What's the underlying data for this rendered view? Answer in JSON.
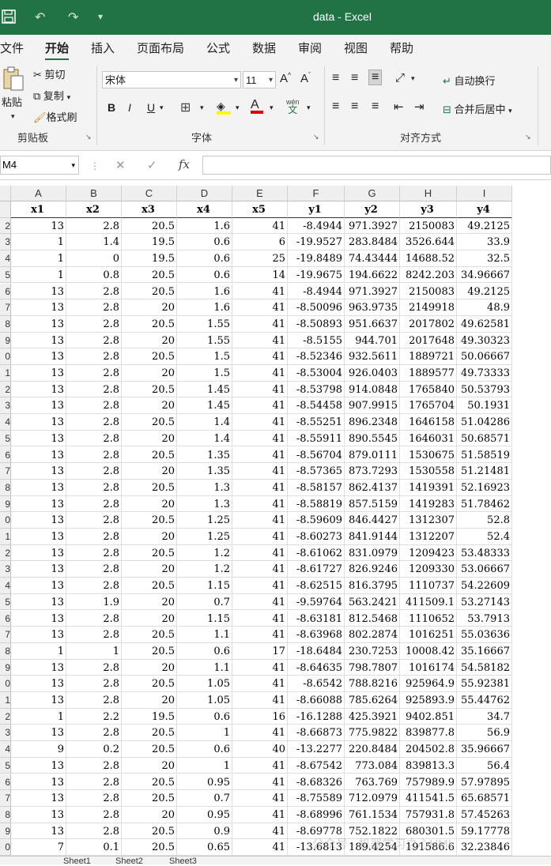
{
  "titlebar": {
    "title": "data  -  Excel",
    "accent": "#217346"
  },
  "tabs": [
    "文件",
    "开始",
    "插入",
    "页面布局",
    "公式",
    "数据",
    "审阅",
    "视图",
    "帮助"
  ],
  "clipboard": {
    "paste": "粘贴",
    "cut": "剪切",
    "copy": "复制",
    "format_painter": "格式刷",
    "label": "剪贴板"
  },
  "font": {
    "name": "宋体",
    "size": "11",
    "bold": "B",
    "italic": "I",
    "underline": "U",
    "label": "字体",
    "grow": "A^",
    "shrink": "Aˇ",
    "phonetic": "wén"
  },
  "alignment": {
    "wrap": "自动换行",
    "merge": "合并后居中",
    "label": "对齐方式"
  },
  "formula_bar": {
    "name_box": "M4",
    "fx": "fx",
    "cancel": "✕",
    "enter": "✓"
  },
  "columns": [
    "A",
    "B",
    "C",
    "D",
    "E",
    "F",
    "G",
    "H",
    "I"
  ],
  "row_labels": [
    "",
    "2",
    "3",
    "4",
    "5",
    "6",
    "7",
    "8",
    "9",
    "0",
    "1",
    "2",
    "3",
    "4",
    "5",
    "6",
    "7",
    "8",
    "9",
    "0",
    "1",
    "2",
    "3",
    "4",
    "5",
    "6",
    "7",
    "8",
    "9",
    "0",
    "1",
    "2",
    "3",
    "4",
    "5",
    "6",
    "7",
    "8",
    "9",
    "0"
  ],
  "header_row": [
    "x1",
    "x2",
    "x3",
    "x4",
    "x5",
    "y1",
    "y2",
    "y3",
    "y4"
  ],
  "rows": [
    [
      "13",
      "2.8",
      "20.5",
      "1.6",
      "41",
      "-8.4944",
      "971.3927",
      "2150083",
      "49.2125"
    ],
    [
      "1",
      "1.4",
      "19.5",
      "0.6",
      "6",
      "-19.9527",
      "283.8484",
      "3526.644",
      "33.9"
    ],
    [
      "1",
      "0",
      "19.5",
      "0.6",
      "25",
      "-19.8489",
      "74.43444",
      "14688.52",
      "32.5"
    ],
    [
      "1",
      "0.8",
      "20.5",
      "0.6",
      "14",
      "-19.9675",
      "194.6622",
      "8242.203",
      "34.96667"
    ],
    [
      "13",
      "2.8",
      "20.5",
      "1.6",
      "41",
      "-8.4944",
      "971.3927",
      "2150083",
      "49.2125"
    ],
    [
      "13",
      "2.8",
      "20",
      "1.6",
      "41",
      "-8.50096",
      "963.9735",
      "2149918",
      "48.9"
    ],
    [
      "13",
      "2.8",
      "20.5",
      "1.55",
      "41",
      "-8.50893",
      "951.6637",
      "2017802",
      "49.62581"
    ],
    [
      "13",
      "2.8",
      "20",
      "1.55",
      "41",
      "-8.5155",
      "944.701",
      "2017648",
      "49.30323"
    ],
    [
      "13",
      "2.8",
      "20.5",
      "1.5",
      "41",
      "-8.52346",
      "932.5611",
      "1889721",
      "50.06667"
    ],
    [
      "13",
      "2.8",
      "20",
      "1.5",
      "41",
      "-8.53004",
      "926.0403",
      "1889577",
      "49.73333"
    ],
    [
      "13",
      "2.8",
      "20.5",
      "1.45",
      "41",
      "-8.53798",
      "914.0848",
      "1765840",
      "50.53793"
    ],
    [
      "13",
      "2.8",
      "20",
      "1.45",
      "41",
      "-8.54458",
      "907.9915",
      "1765704",
      "50.1931"
    ],
    [
      "13",
      "2.8",
      "20.5",
      "1.4",
      "41",
      "-8.55251",
      "896.2348",
      "1646158",
      "51.04286"
    ],
    [
      "13",
      "2.8",
      "20",
      "1.4",
      "41",
      "-8.55911",
      "890.5545",
      "1646031",
      "50.68571"
    ],
    [
      "13",
      "2.8",
      "20.5",
      "1.35",
      "41",
      "-8.56704",
      "879.0111",
      "1530675",
      "51.58519"
    ],
    [
      "13",
      "2.8",
      "20",
      "1.35",
      "41",
      "-8.57365",
      "873.7293",
      "1530558",
      "51.21481"
    ],
    [
      "13",
      "2.8",
      "20.5",
      "1.3",
      "41",
      "-8.58157",
      "862.4137",
      "1419391",
      "52.16923"
    ],
    [
      "13",
      "2.8",
      "20",
      "1.3",
      "41",
      "-8.58819",
      "857.5159",
      "1419283",
      "51.78462"
    ],
    [
      "13",
      "2.8",
      "20.5",
      "1.25",
      "41",
      "-8.59609",
      "846.4427",
      "1312307",
      "52.8"
    ],
    [
      "13",
      "2.8",
      "20",
      "1.25",
      "41",
      "-8.60273",
      "841.9144",
      "1312207",
      "52.4"
    ],
    [
      "13",
      "2.8",
      "20.5",
      "1.2",
      "41",
      "-8.61062",
      "831.0979",
      "1209423",
      "53.48333"
    ],
    [
      "13",
      "2.8",
      "20",
      "1.2",
      "41",
      "-8.61727",
      "826.9246",
      "1209330",
      "53.06667"
    ],
    [
      "13",
      "2.8",
      "20.5",
      "1.15",
      "41",
      "-8.62515",
      "816.3795",
      "1110737",
      "54.22609"
    ],
    [
      "13",
      "1.9",
      "20",
      "0.7",
      "41",
      "-9.59764",
      "563.2421",
      "411509.1",
      "53.27143"
    ],
    [
      "13",
      "2.8",
      "20",
      "1.15",
      "41",
      "-8.63181",
      "812.5468",
      "1110652",
      "53.7913"
    ],
    [
      "13",
      "2.8",
      "20.5",
      "1.1",
      "41",
      "-8.63968",
      "802.2874",
      "1016251",
      "55.03636"
    ],
    [
      "1",
      "1",
      "20.5",
      "0.6",
      "17",
      "-18.6484",
      "230.7253",
      "10008.42",
      "35.16667"
    ],
    [
      "13",
      "2.8",
      "20",
      "1.1",
      "41",
      "-8.64635",
      "798.7807",
      "1016174",
      "54.58182"
    ],
    [
      "13",
      "2.8",
      "20.5",
      "1.05",
      "41",
      "-8.6542",
      "788.8216",
      "925964.9",
      "55.92381"
    ],
    [
      "13",
      "2.8",
      "20",
      "1.05",
      "41",
      "-8.66088",
      "785.6264",
      "925893.9",
      "55.44762"
    ],
    [
      "1",
      "2.2",
      "19.5",
      "0.6",
      "16",
      "-16.1288",
      "425.3921",
      "9402.851",
      "34.7"
    ],
    [
      "13",
      "2.8",
      "20.5",
      "1",
      "41",
      "-8.66873",
      "775.9822",
      "839877.8",
      "56.9"
    ],
    [
      "9",
      "0.2",
      "20.5",
      "0.6",
      "40",
      "-13.2277",
      "220.8484",
      "204502.8",
      "35.96667"
    ],
    [
      "13",
      "2.8",
      "20",
      "1",
      "41",
      "-8.67542",
      "773.084",
      "839813.3",
      "56.4"
    ],
    [
      "13",
      "2.8",
      "20.5",
      "0.95",
      "41",
      "-8.68326",
      "763.769",
      "757989.9",
      "57.97895"
    ],
    [
      "13",
      "2.8",
      "20.5",
      "0.7",
      "41",
      "-8.75589",
      "712.0979",
      "411541.5",
      "65.68571"
    ],
    [
      "13",
      "2.8",
      "20",
      "0.95",
      "41",
      "-8.68996",
      "761.1534",
      "757931.8",
      "57.45263"
    ],
    [
      "13",
      "2.8",
      "20.5",
      "0.9",
      "41",
      "-8.69778",
      "752.1822",
      "680301.5",
      "59.17778"
    ],
    [
      "7",
      "0.1",
      "20.5",
      "0.65",
      "41",
      "-13.6813",
      "189.4254",
      "191586.6",
      "32.23846"
    ]
  ],
  "sheets": [
    "Sheet1",
    "Sheet2",
    "Sheet3"
  ],
  "watermark": "公众号 · 机器学习之心HML"
}
